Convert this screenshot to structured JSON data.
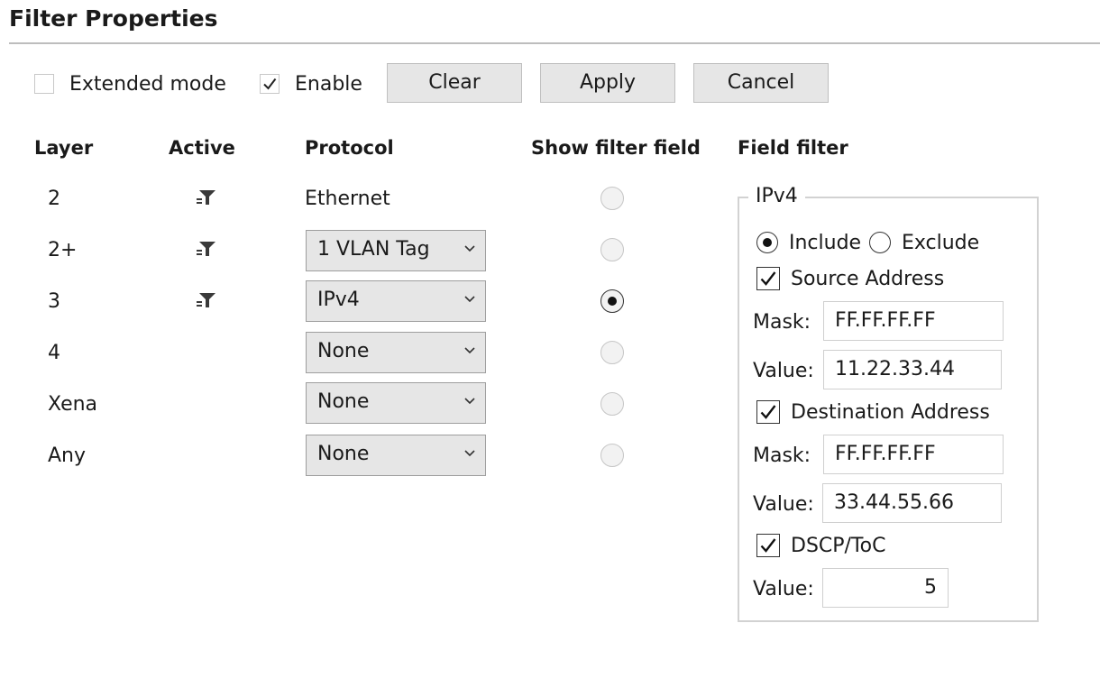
{
  "title": "Filter Properties",
  "toolbar": {
    "extended_mode": {
      "label": "Extended mode",
      "checked": false
    },
    "enable": {
      "label": "Enable",
      "checked": true
    },
    "clear_label": "Clear",
    "apply_label": "Apply",
    "cancel_label": "Cancel"
  },
  "columns": {
    "layer": "Layer",
    "active": "Active",
    "protocol": "Protocol",
    "show_filter_field": "Show filter field",
    "field_filter": "Field filter"
  },
  "rows": [
    {
      "layer": "2",
      "active": true,
      "protocol": "Ethernet",
      "dropdown": false,
      "show": false
    },
    {
      "layer": "2+",
      "active": true,
      "protocol": "1 VLAN Tag",
      "dropdown": true,
      "show": false
    },
    {
      "layer": "3",
      "active": true,
      "protocol": "IPv4",
      "dropdown": true,
      "show": true
    },
    {
      "layer": "4",
      "active": false,
      "protocol": "None",
      "dropdown": true,
      "show": false
    },
    {
      "layer": "Xena",
      "active": false,
      "protocol": "None",
      "dropdown": true,
      "show": false
    },
    {
      "layer": "Any",
      "active": false,
      "protocol": "None",
      "dropdown": true,
      "show": false
    }
  ],
  "field_filter": {
    "group_title": "IPv4",
    "include_label": "Include",
    "exclude_label": "Exclude",
    "mode": "include",
    "source": {
      "label": "Source Address",
      "checked": true,
      "mask_label": "Mask:",
      "mask": "FF.FF.FF.FF",
      "value_label": "Value:",
      "value": "11.22.33.44"
    },
    "destination": {
      "label": "Destination Address",
      "checked": true,
      "mask_label": "Mask:",
      "mask": "FF.FF.FF.FF",
      "value_label": "Value:",
      "value": "33.44.55.66"
    },
    "dscp": {
      "label": "DSCP/ToC",
      "checked": true,
      "value_label": "Value:",
      "value": "5"
    }
  },
  "icons": {
    "active": "filter-icon",
    "dropdown": "chevron-down-icon",
    "check": "checkmark-icon"
  }
}
